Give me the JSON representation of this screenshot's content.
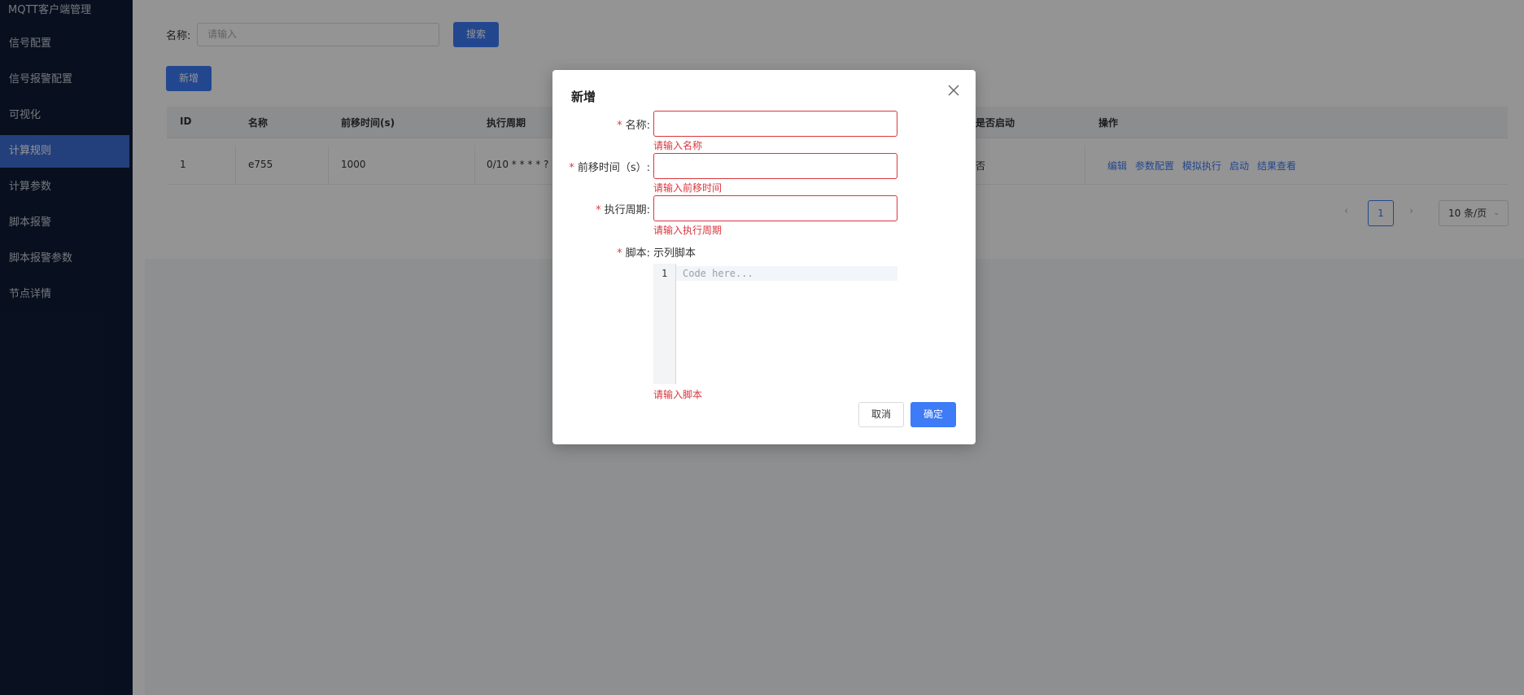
{
  "sidebar": {
    "title": "MQTT客户端管理",
    "items": [
      {
        "label": "信号配置"
      },
      {
        "label": "信号报警配置"
      },
      {
        "label": "可视化"
      },
      {
        "label": "计算规则",
        "active": true
      },
      {
        "label": "计算参数"
      },
      {
        "label": "脚本报警"
      },
      {
        "label": "脚本报警参数"
      },
      {
        "label": "节点详情"
      }
    ]
  },
  "search": {
    "label": "名称:",
    "placeholder": "请输入",
    "button_label": "搜索"
  },
  "toolbar": {
    "add_label": "新增"
  },
  "table": {
    "columns": [
      "ID",
      "名称",
      "前移时间(s)",
      "执行周期",
      "是否启动",
      "操作"
    ],
    "rows": [
      {
        "id": "1",
        "name": "e755",
        "shift_time": "1000",
        "cycle": "0/10 * * * * ?",
        "enabled": "否",
        "actions": [
          "编辑",
          "参数配置",
          "模拟执行",
          "启动",
          "结果查看"
        ]
      }
    ]
  },
  "pagination": {
    "prev": "‹",
    "current_page": "1",
    "next": "›",
    "page_size": "10 条/页"
  },
  "modal": {
    "title": "新增",
    "fields": {
      "name": {
        "label": "名称:",
        "error": "请输入名称"
      },
      "shift_time": {
        "label": "前移时间（s）:",
        "error": "请输入前移时间"
      },
      "cycle": {
        "label": "执行周期:",
        "error": "请输入执行周期"
      },
      "script": {
        "label": "脚本:",
        "sample_link": "示列脚本",
        "error": "请输入脚本"
      }
    },
    "editor": {
      "line_number": "1",
      "placeholder": "Code here..."
    },
    "cancel_label": "取消",
    "ok_label": "确定"
  },
  "colors": {
    "sidebar_bg": "#0f1c36",
    "accent": "#3d7bf7",
    "error": "#d9363e"
  }
}
